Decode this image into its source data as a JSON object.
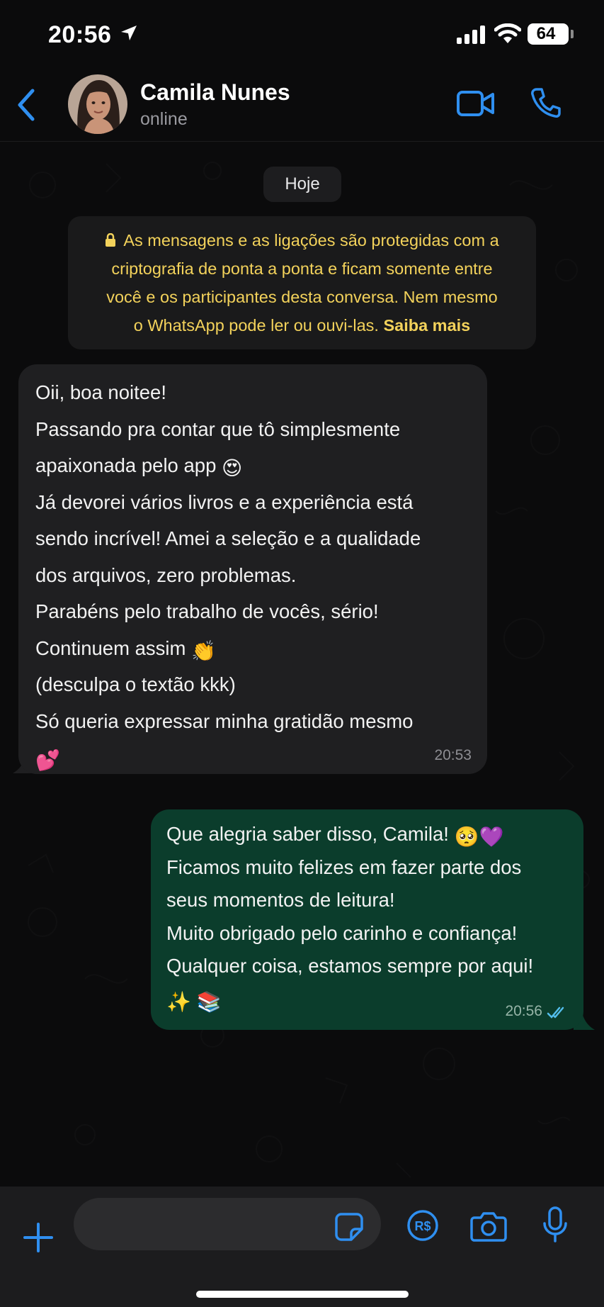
{
  "status_bar": {
    "time": "20:56",
    "battery": "64"
  },
  "header": {
    "contact_name": "Camila Nunes",
    "contact_status": "online"
  },
  "chat": {
    "date_label": "Hoje",
    "encryption_notice": {
      "lines": [
        "As mensagens e as ligações são protegidas com a",
        "criptografia de ponta a ponta e ficam somente entre",
        "você e os participantes desta conversa. Nem mesmo",
        "o WhatsApp pode ler ou ouvi-las."
      ],
      "learn_more": "Saiba mais"
    },
    "messages": [
      {
        "direction": "incoming",
        "lines": [
          "Oii, boa noitee!",
          "Passando pra contar que tô simplesmente",
          "apaixonada pelo app",
          "Já devorei vários livros e a experiência está",
          "sendo incrível! Amei a seleção e a qualidade",
          "dos arquivos, zero problemas.",
          "Parabéns pelo trabalho de vocês, sério!",
          "Continuem assim",
          "(desculpa o textão kkk)",
          "Só queria expressar minha gratidão mesmo"
        ],
        "emojis": {
          "heart_eyes": "😍",
          "clap": "👏",
          "hearts": "💕"
        },
        "time": "20:53"
      },
      {
        "direction": "outgoing",
        "lines": [
          "Que alegria saber disso, Camila!",
          "Ficamos muito felizes em fazer parte dos",
          "seus momentos de leitura!",
          "Muito obrigado pelo carinho e confiança!",
          "Qualquer coisa, estamos sempre por aqui!"
        ],
        "emojis": {
          "pleading": "🥺",
          "purple_heart": "💜",
          "sparkles": "✨",
          "books": "📚"
        },
        "time": "20:56",
        "status": "read"
      }
    ]
  },
  "input_bar": {
    "message_value": ""
  },
  "colors": {
    "accent": "#2f8ff0",
    "incoming_bubble": "#1f1f21",
    "outgoing_bubble": "#0b3d2c",
    "encryption_text": "#f3d25b",
    "read_ticks": "#53bdeb"
  }
}
